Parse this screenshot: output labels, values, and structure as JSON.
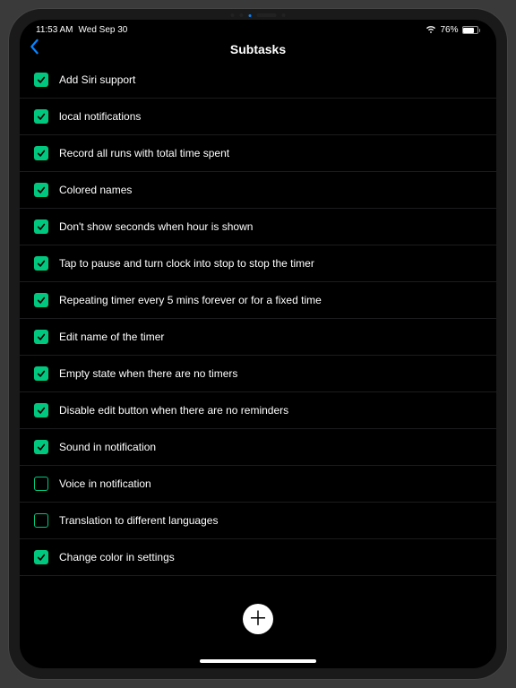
{
  "status": {
    "time": "11:53 AM",
    "date": "Wed Sep 30",
    "battery_pct": "76%"
  },
  "nav": {
    "title": "Subtasks"
  },
  "subtasks": [
    {
      "label": "Add Siri support",
      "checked": true
    },
    {
      "label": "local notifications",
      "checked": true
    },
    {
      "label": "Record all runs with total time spent",
      "checked": true
    },
    {
      "label": "Colored names",
      "checked": true
    },
    {
      "label": "Don't show seconds when hour is shown",
      "checked": true
    },
    {
      "label": "Tap to pause and turn clock into stop to stop the timer",
      "checked": true
    },
    {
      "label": "Repeating timer every 5 mins forever or for a fixed time",
      "checked": true
    },
    {
      "label": "Edit name of the timer",
      "checked": true
    },
    {
      "label": "Empty state when there are no timers",
      "checked": true
    },
    {
      "label": "Disable edit button when there are no reminders",
      "checked": true
    },
    {
      "label": "Sound in notification",
      "checked": true
    },
    {
      "label": "Voice in notification",
      "checked": false
    },
    {
      "label": "Translation to different languages",
      "checked": false
    },
    {
      "label": "Change color in settings",
      "checked": true
    }
  ],
  "colors": {
    "accent": "#00c87f",
    "link": "#0a84ff"
  }
}
